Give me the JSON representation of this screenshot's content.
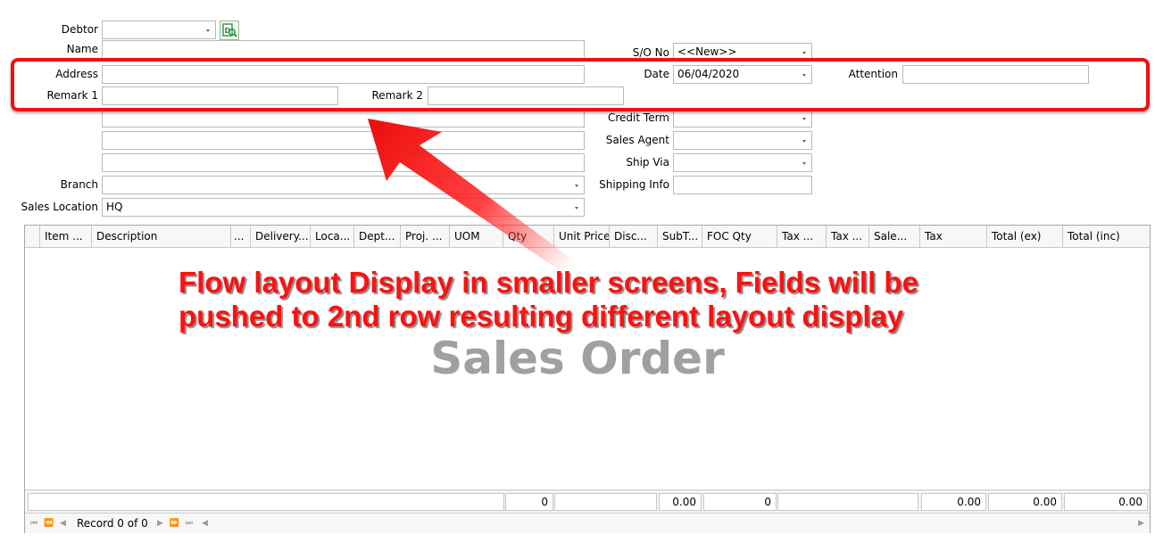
{
  "labels": {
    "debtor": "Debtor",
    "name": "Name",
    "address": "Address",
    "remark1": "Remark 1",
    "remark2": "Remark 2",
    "branch": "Branch",
    "sales_location": "Sales Location",
    "so_no": "S/O No",
    "date": "Date",
    "attention": "Attention",
    "credit_term": "Credit Term",
    "sales_agent": "Sales Agent",
    "ship_via": "Ship Via",
    "shipping_info": "Shipping Info"
  },
  "values": {
    "so_no": "<<New>>",
    "date": "06/04/2020",
    "sales_location": "HQ"
  },
  "grid": {
    "columns": [
      "Item ...",
      "Description",
      "...",
      "Delivery...",
      "Loca...",
      "Dept...",
      "Proj. ...",
      "UOM",
      "Qty",
      "Unit Price",
      "Disc...",
      "SubT...",
      "FOC Qty",
      "Tax ...",
      "Tax ...",
      "Sale...",
      "Tax",
      "Total (ex)",
      "Total (inc)"
    ],
    "watermark": "Sales Order",
    "footer": {
      "qty": "0",
      "subtotal": "0.00",
      "foc_qty": "0",
      "tax": "0.00",
      "total_ex": "0.00",
      "total_inc": "0.00"
    },
    "navigator": "Record 0 of 0"
  },
  "annotation": {
    "line1": "Flow layout Display in smaller screens, Fields will be",
    "line2": "pushed to 2nd row resulting different layout display"
  },
  "colors": {
    "annotation": "#ff1010",
    "watermark": "#a0a0a0",
    "field_border": "#b9b9b9"
  }
}
